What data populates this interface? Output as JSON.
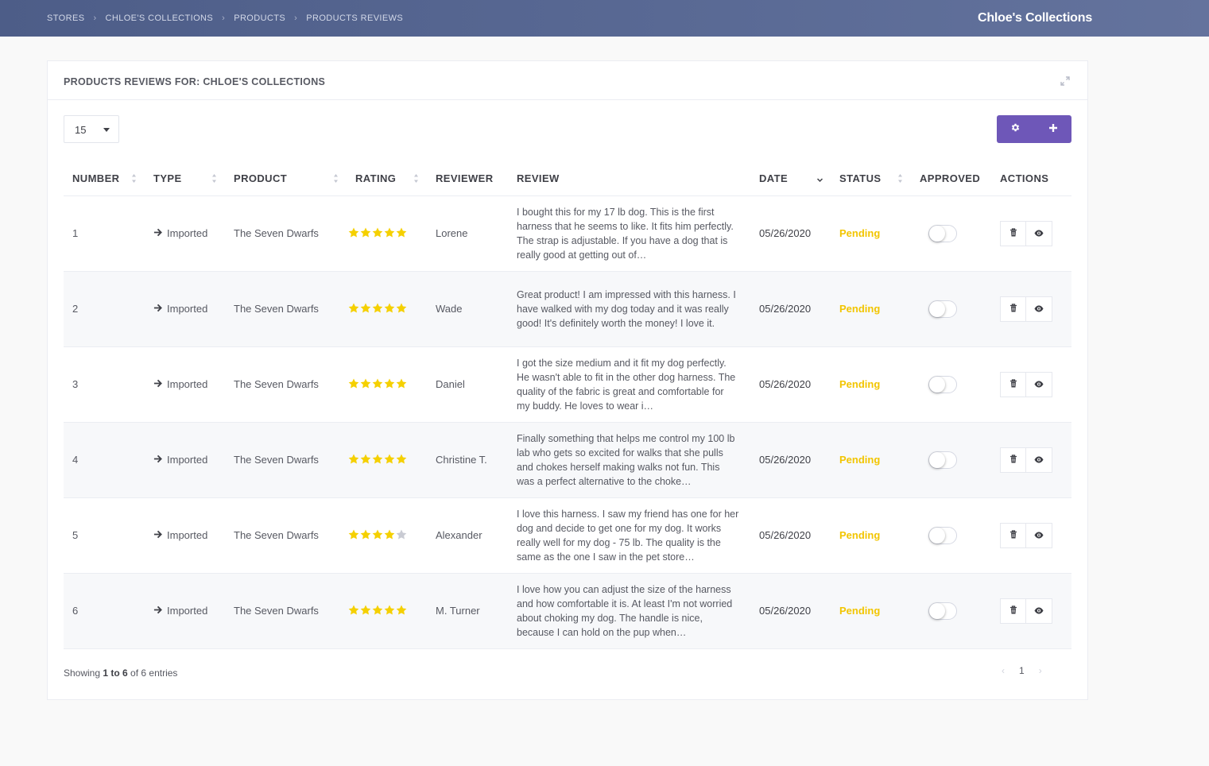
{
  "breadcrumb": [
    {
      "label": "STORES"
    },
    {
      "label": "CHLOE'S COLLECTIONS"
    },
    {
      "label": "PRODUCTS"
    },
    {
      "label": "PRODUCTS REVIEWS"
    }
  ],
  "store_name": "Chloe's Collections",
  "portlet": {
    "title": "PRODUCTS REVIEWS FOR: CHLOE'S COLLECTIONS"
  },
  "page_length": {
    "value": "15"
  },
  "columns": {
    "number": "NUMBER",
    "type": "TYPE",
    "product": "PRODUCT",
    "rating": "RATING",
    "reviewer": "REVIEWER",
    "review": "REVIEW",
    "date": "DATE",
    "status": "STATUS",
    "approved": "APPROVED",
    "actions": "ACTIONS"
  },
  "rows": [
    {
      "number": "1",
      "type": "Imported",
      "product": "The Seven Dwarfs",
      "rating": 5,
      "reviewer": "Lorene",
      "review": "I bought this for my 17 lb dog. This is the first harness that he seems to like. It fits him perfectly. The strap is adjustable. If you have a dog that is really good at getting out of…",
      "date": "05/26/2020",
      "status": "Pending",
      "approved": false
    },
    {
      "number": "2",
      "type": "Imported",
      "product": "The Seven Dwarfs",
      "rating": 5,
      "reviewer": "Wade",
      "review": "Great product! I am impressed with this harness. I have walked with my dog today and it was really good! It's definitely worth the money! I love it.",
      "date": "05/26/2020",
      "status": "Pending",
      "approved": false
    },
    {
      "number": "3",
      "type": "Imported",
      "product": "The Seven Dwarfs",
      "rating": 5,
      "reviewer": "Daniel",
      "review": "I got the size medium and it fit my dog perfectly. He wasn't able to fit in the other dog harness. The quality of the fabric is great and comfortable for my buddy. He loves to wear i…",
      "date": "05/26/2020",
      "status": "Pending",
      "approved": false
    },
    {
      "number": "4",
      "type": "Imported",
      "product": "The Seven Dwarfs",
      "rating": 5,
      "reviewer": "Christine T.",
      "review": "Finally something that helps me control my 100 lb lab who gets so excited for walks that she pulls and chokes herself making walks not fun. This was a perfect alternative to the choke…",
      "date": "05/26/2020",
      "status": "Pending",
      "approved": false
    },
    {
      "number": "5",
      "type": "Imported",
      "product": "The Seven Dwarfs",
      "rating": 4,
      "reviewer": "Alexander",
      "review": "I love this harness. I saw my friend has one for her dog and decide to get one for my dog. It works really well for my dog - 75 lb. The quality is the same as the one I saw in the pet store…",
      "date": "05/26/2020",
      "status": "Pending",
      "approved": false
    },
    {
      "number": "6",
      "type": "Imported",
      "product": "The Seven Dwarfs",
      "rating": 5,
      "reviewer": "M. Turner",
      "review": "I love how you can adjust the size of the harness and how comfortable it is. At least I'm not worried about choking my dog. The handle is nice, because I can hold on the pup when…",
      "date": "05/26/2020",
      "status": "Pending",
      "approved": false
    }
  ],
  "info": {
    "prefix": "Showing ",
    "range": "1 to 6",
    "suffix": " of 6 entries"
  },
  "pagination": {
    "prev": "‹",
    "current": "1",
    "next": "›"
  },
  "colors": {
    "accent": "#6e57b8",
    "pending": "#f2c500",
    "star_on": "#f5d000",
    "star_off": "#c9cbd3",
    "header": "#53638f"
  },
  "icons": {
    "expand": "expand-icon",
    "settings": "gear-icon",
    "add": "plus-icon",
    "delete": "trash-icon",
    "view": "eye-icon",
    "type": "arrow-right-icon",
    "sort": "sort-icon"
  }
}
